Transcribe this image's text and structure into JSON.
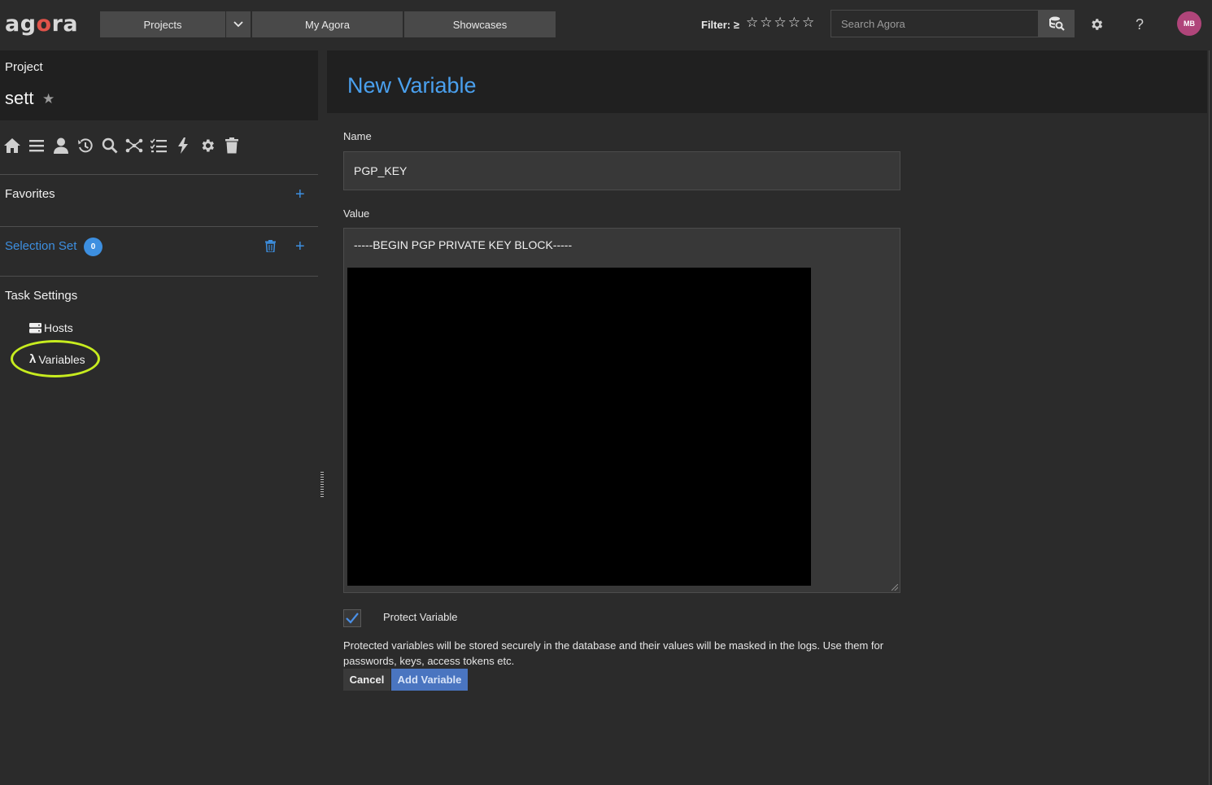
{
  "brand": {
    "part1": "ag",
    "accent_letter": "o",
    "part2": "ra"
  },
  "nav": {
    "projects": "Projects",
    "my_agora": "My Agora",
    "showcases": "Showcases"
  },
  "filter": {
    "label": "Filter: ≥",
    "stars": [
      "☆",
      "☆",
      "☆",
      "☆",
      "☆"
    ]
  },
  "search": {
    "placeholder": "Search Agora"
  },
  "user": {
    "initials": "MB"
  },
  "project": {
    "label": "Project",
    "name": "sett",
    "favorite_icon": "star-icon"
  },
  "sidebar": {
    "toolbar_icons": [
      "home-icon",
      "list-icon",
      "user-icon",
      "history-icon",
      "search-icon",
      "flow-icon",
      "checklist-icon",
      "bolt-icon",
      "gear-icon",
      "trash-icon"
    ],
    "favorites": "Favorites",
    "selection_set": "Selection Set",
    "selection_count": "0",
    "task_settings": "Task Settings",
    "hosts": "Hosts",
    "variables": "Variables"
  },
  "form": {
    "title": "New Variable",
    "name_label": "Name",
    "name_value": "PGP_KEY",
    "value_label": "Value",
    "value_first_line": "-----BEGIN PGP PRIVATE KEY BLOCK-----",
    "protect_label": "Protect Variable",
    "protect_checked": true,
    "help_text": "Protected variables will be stored securely in the database and their values will be masked in the logs. Use them for passwords, keys, access tokens etc.",
    "cancel": "Cancel",
    "add": "Add Variable"
  },
  "colors": {
    "accent": "#3d8fe0",
    "title_blue": "#4aa0ee",
    "add_button": "#4a75c0",
    "avatar": "#b0457a",
    "highlight": "#c7ec1f",
    "logo_accent": "#e0534a"
  }
}
